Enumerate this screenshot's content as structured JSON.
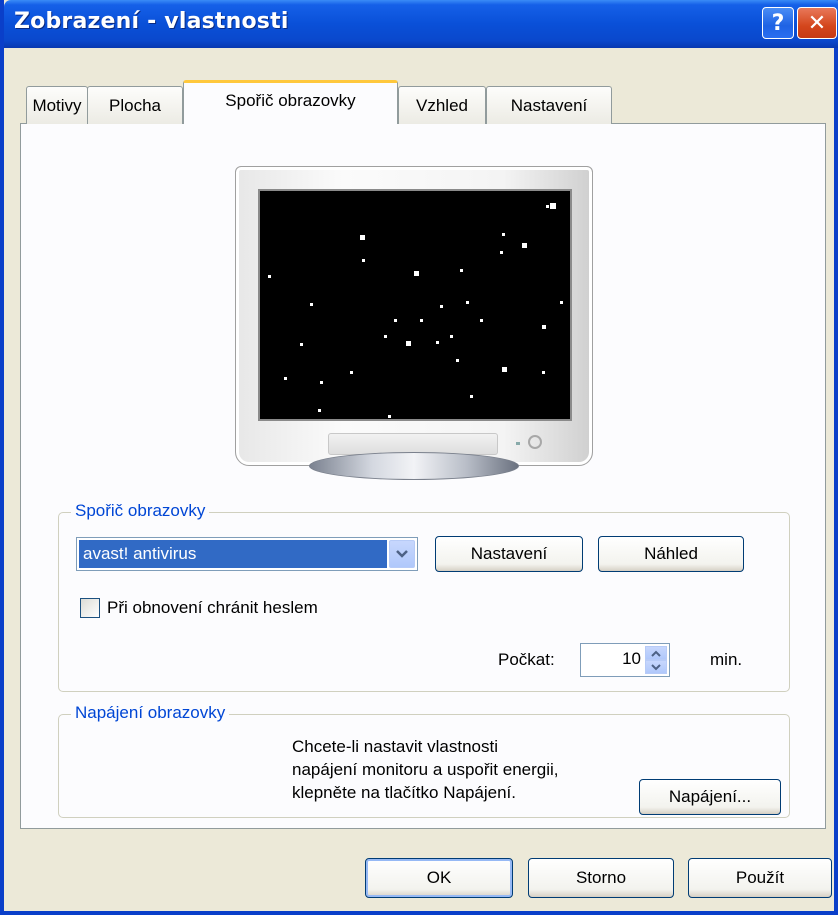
{
  "window": {
    "title": "Zobrazení - vlastnosti",
    "help_label": "?",
    "close_label": "✕"
  },
  "tabs": [
    {
      "label": "Motivy",
      "active": false
    },
    {
      "label": "Plocha",
      "active": false
    },
    {
      "label": "Spořič obrazovky",
      "active": true
    },
    {
      "label": "Vzhled",
      "active": false
    },
    {
      "label": "Nastavení",
      "active": false
    }
  ],
  "screensaver": {
    "group_label": "Spořič obrazovky",
    "selected": "avast! antivirus",
    "settings_button": "Nastavení",
    "preview_button": "Náhled",
    "password_checkbox_label": "Při obnovení chránit heslem",
    "password_checked": false,
    "wait_label": "Počkat:",
    "wait_value": "10",
    "wait_unit": "min."
  },
  "power": {
    "group_label": "Napájení obrazovky",
    "line1": "Chcete-li nastavit vlastnosti",
    "line2": "napájení monitoru a uspořit energii,",
    "line3": "klepněte na tlačítko Napájení.",
    "button": "Napájení..."
  },
  "footer": {
    "ok": "OK",
    "cancel": "Storno",
    "apply": "Použít"
  },
  "colors": {
    "titlebar": "#0a50d8",
    "accent_legend": "#0046d5",
    "tab_highlight": "#ffc83c",
    "selection": "#316ac5"
  }
}
